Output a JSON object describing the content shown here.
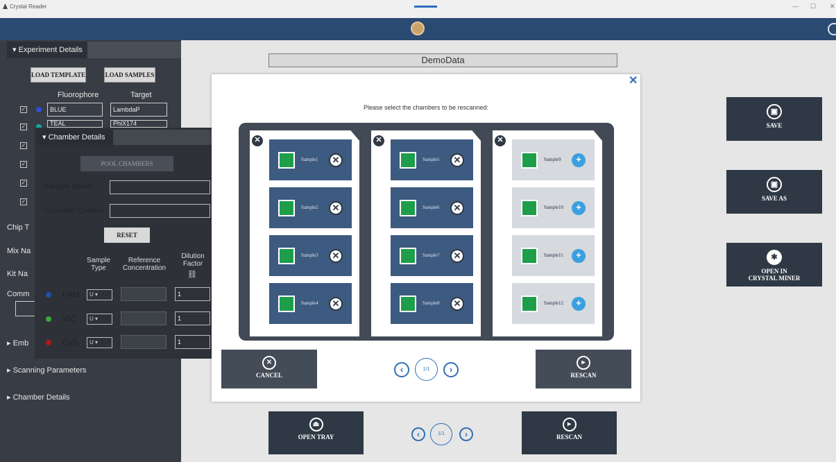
{
  "window": {
    "title": "Crystal Reader",
    "controls": [
      "—",
      "☐",
      "✕"
    ]
  },
  "experiment": {
    "tab_label": "Experiment Details",
    "load_template": "LOAD TEMPLATE",
    "load_samples": "LOAD SAMPLES",
    "col_fluorophore": "Fluorophore",
    "col_target": "Target",
    "rows": [
      {
        "fluor": "BLUE",
        "target": "LambdaP",
        "color": "#2f4fd8"
      },
      {
        "fluor": "TEAL",
        "target": "PhiX174",
        "color": "#1aa6a6"
      }
    ],
    "chip_label": "Chip T",
    "mix_label": "Mix Na",
    "kit_label": "Kit Na",
    "comments_label": "Comm",
    "embed_label": "Emb",
    "scanning_params": "Scanning Parameters",
    "chamber_details": "Chamber Details"
  },
  "chamber": {
    "tab_label": "Chamber Details",
    "pool_chambers": "POOL CHAMBERS",
    "sample_name_label": "Sample Name",
    "sample_name_value": "",
    "context_label": "Chamber Context",
    "context_value": "",
    "reset": "RESET",
    "col_sample_type": "Sample Type",
    "col_ref_conc": "Reference Concentration",
    "col_dilution": "Dilution Factor",
    "link_icon": "⛓",
    "dyes": [
      {
        "name": "FAM",
        "type": "U",
        "dilution": "1",
        "color": "#1f4fa8"
      },
      {
        "name": "VIC",
        "type": "U",
        "dilution": "1",
        "color": "#3aa83a"
      },
      {
        "name": "Cy5",
        "type": "U",
        "dilution": "1",
        "color": "#b01818"
      }
    ]
  },
  "main": {
    "experiment_name": "DemoData",
    "save": "SAVE",
    "save_as": "SAVE AS",
    "open_in": "OPEN IN",
    "crystal_miner": "CRYSTAL MINER",
    "open_tray": "OPEN TRAY",
    "rescan": "RESCAN",
    "page": "1/1"
  },
  "modal": {
    "prompt": "Please select the chambers to be rescanned:",
    "cancel": "CANCEL",
    "rescan": "RESCAN",
    "page": "1/1",
    "close": "✕",
    "plates": [
      {
        "wells": [
          {
            "name": "Sample1",
            "selected": true
          },
          {
            "name": "Sample2",
            "selected": true
          },
          {
            "name": "Sample3",
            "selected": true
          },
          {
            "name": "Sample4",
            "selected": true
          }
        ]
      },
      {
        "wells": [
          {
            "name": "Sample5",
            "selected": true
          },
          {
            "name": "Sample6",
            "selected": true
          },
          {
            "name": "Sample7",
            "selected": true
          },
          {
            "name": "Sample8",
            "selected": true
          }
        ]
      },
      {
        "wells": [
          {
            "name": "Sample9",
            "selected": false
          },
          {
            "name": "Sample10",
            "selected": false
          },
          {
            "name": "Sample11",
            "selected": false
          },
          {
            "name": "Sample12",
            "selected": false
          }
        ]
      }
    ]
  }
}
